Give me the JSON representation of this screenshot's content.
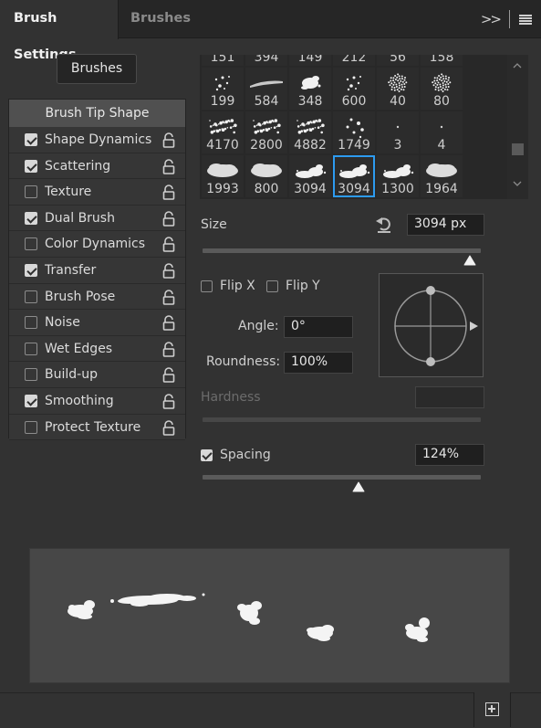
{
  "tabs": {
    "active": "Brush Settings",
    "inactive": "Brushes"
  },
  "toolbar": {
    "collapse_icon": "double-chevron-right-icon",
    "menu_icon": "hamburger-menu-icon"
  },
  "left_panel": {
    "brushes_button": "Brushes",
    "header": "Brush Tip Shape",
    "items": [
      {
        "label": "Shape Dynamics",
        "checked": true
      },
      {
        "label": "Scattering",
        "checked": true
      },
      {
        "label": "Texture",
        "checked": false
      },
      {
        "label": "Dual Brush",
        "checked": true
      },
      {
        "label": "Color Dynamics",
        "checked": false
      },
      {
        "label": "Transfer",
        "checked": true
      },
      {
        "label": "Brush Pose",
        "checked": false
      },
      {
        "label": "Noise",
        "checked": false
      },
      {
        "label": "Wet Edges",
        "checked": false
      },
      {
        "label": "Build-up",
        "checked": false
      },
      {
        "label": "Smoothing",
        "checked": true
      },
      {
        "label": "Protect Texture",
        "checked": false
      }
    ]
  },
  "presets": {
    "top_partial": [
      "151",
      "394",
      "149",
      "212",
      "56",
      "158"
    ],
    "rows": [
      [
        "199",
        "584",
        "348",
        "600",
        "40",
        "80"
      ],
      [
        "4170",
        "2800",
        "4882",
        "1749",
        "3",
        "4"
      ],
      [
        "1993",
        "800",
        "3094",
        "3094",
        "1300",
        "1964"
      ]
    ],
    "selected_index": 3
  },
  "size": {
    "label": "Size",
    "value": "3094 px",
    "reset_icon": "reset-arrow-icon",
    "slider_fraction": 0.96
  },
  "flip": {
    "flip_x": "Flip X",
    "flip_y": "Flip Y",
    "flip_x_checked": false,
    "flip_y_checked": false
  },
  "angle": {
    "label": "Angle:",
    "value": "0°"
  },
  "roundness": {
    "label": "Roundness:",
    "value": "100%"
  },
  "hardness": {
    "label": "Hardness",
    "value": ""
  },
  "spacing": {
    "label": "Spacing",
    "value": "124%",
    "checked": true,
    "slider_fraction": 0.56
  },
  "footer": {
    "new_preset_icon": "new-brush-preset-icon"
  },
  "colors": {
    "selection": "#2d9bf0",
    "panel": "#323232",
    "header": "#505050"
  }
}
